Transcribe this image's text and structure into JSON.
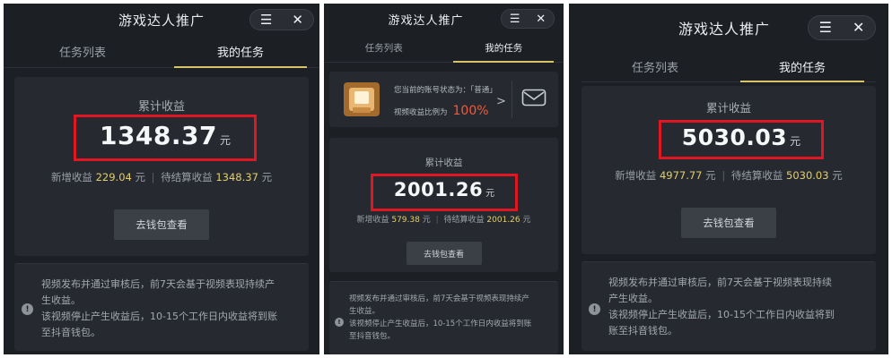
{
  "panels": [
    {
      "title": "游戏达人推广",
      "tabs": [
        "任务列表",
        "我的任务"
      ],
      "earnings_label": "累计收益",
      "amount": "1348.37",
      "unit": "元",
      "new_label": "新增收益",
      "new_value": "229.04",
      "pending_label": "待结算收益",
      "pending_value": "1348.37",
      "wallet_button": "去钱包查看",
      "notice_lines": [
        "视频发布并通过审核后，前7天会基于视频表现持续产",
        "生收益。",
        "该视频停止产生收益后，10-15个工作日内收益将到账",
        "至抖音钱包。"
      ]
    },
    {
      "title": "游戏达人推广",
      "tabs": [
        "任务列表",
        "我的任务"
      ],
      "account_status": "您当前的账号状态为：「普通」",
      "ratio_label": "视频收益比例为",
      "ratio_value": "100%",
      "earnings_label": "累计收益",
      "amount": "2001.26",
      "unit": "元",
      "new_label": "新增收益",
      "new_value": "579.38",
      "pending_label": "待结算收益",
      "pending_value": "2001.26",
      "wallet_button": "去钱包查看",
      "notice_lines": [
        "视频发布并通过审核后，前7天会基于视频表现持续产",
        "生收益。",
        "该视频停止产生收益后，10-15个工作日内收益将到账",
        "至抖音钱包。"
      ]
    },
    {
      "title": "游戏达人推广",
      "tabs": [
        "任务列表",
        "我的任务"
      ],
      "earnings_label": "累计收益",
      "amount": "5030.03",
      "unit": "元",
      "new_label": "新增收益",
      "new_value": "4977.77",
      "pending_label": "待结算收益",
      "pending_value": "5030.03",
      "wallet_button": "去钱包查看",
      "notice_lines": [
        "视频发布并通过审核后，前7天会基于视频表现持续",
        "产生收益。",
        "该视频停止产生收益后，10-15个工作日内收益将到",
        "账至抖音钱包。"
      ]
    }
  ],
  "header_icons": [
    "menu-icon",
    "close-icon"
  ],
  "notice_icon": "!",
  "colors": {
    "highlight": "#e01722",
    "accent": "#e2cf6a",
    "ratio": "#f2593a",
    "background": "#1c1f23"
  }
}
